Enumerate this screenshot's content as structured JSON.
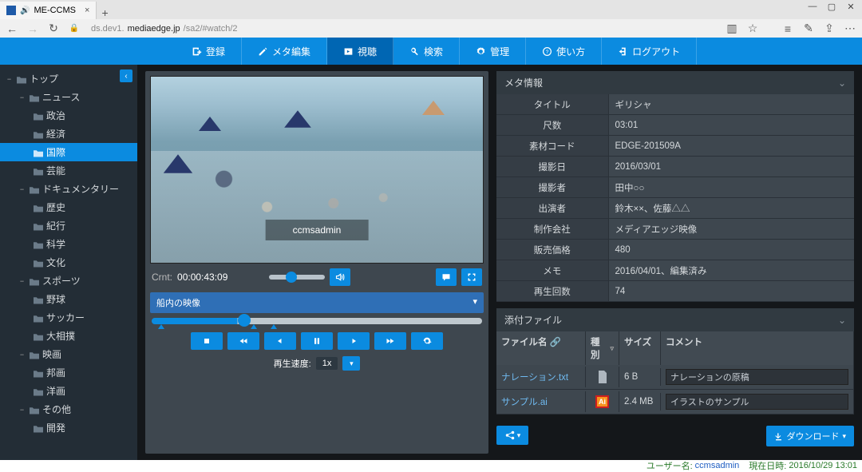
{
  "browser": {
    "tab_title": "ME-CCMS",
    "url_prefix": "ds.dev1.",
    "url_domain": "mediaedge.jp",
    "url_suffix": "/sa2/#watch/2"
  },
  "nav": {
    "register": "登録",
    "meta_edit": "メタ編集",
    "watch": "視聴",
    "search": "検索",
    "manage": "管理",
    "usage": "使い方",
    "logout": "ログアウト"
  },
  "tree": {
    "root": "トップ",
    "cats": [
      {
        "label": "ニュース",
        "children": [
          "政治",
          "経済",
          "国際",
          "芸能"
        ],
        "sel": 2
      },
      {
        "label": "ドキュメンタリー",
        "children": [
          "歴史",
          "紀行",
          "科学",
          "文化"
        ]
      },
      {
        "label": "スポーツ",
        "children": [
          "野球",
          "サッカー",
          "大相撲"
        ]
      },
      {
        "label": "映画",
        "children": [
          "邦画",
          "洋画"
        ]
      },
      {
        "label": "その他",
        "children": [
          "開発"
        ]
      }
    ]
  },
  "player": {
    "watermark": "ccmsadmin",
    "crnt_label": "Crnt:",
    "crnt_value": "00:00:43:09",
    "clip_label": "船内の映像",
    "speed_label": "再生速度:",
    "speed_value": "1x"
  },
  "meta": {
    "head": "メタ情報",
    "rows": [
      {
        "k": "タイトル",
        "v": "ギリシャ"
      },
      {
        "k": "尺数",
        "v": "03:01"
      },
      {
        "k": "素材コード",
        "v": "EDGE-201509A"
      },
      {
        "k": "撮影日",
        "v": "2016/03/01"
      },
      {
        "k": "撮影者",
        "v": "田中○○"
      },
      {
        "k": "出演者",
        "v": "鈴木××、佐藤△△"
      },
      {
        "k": "制作会社",
        "v": "メディアエッジ映像"
      },
      {
        "k": "販売価格",
        "v": "480"
      },
      {
        "k": "メモ",
        "v": "2016/04/01、編集済み"
      },
      {
        "k": "再生回数",
        "v": "74"
      }
    ]
  },
  "attachments": {
    "head": "添付ファイル",
    "cols": {
      "file": "ファイル名",
      "type": "種別",
      "size": "サイズ",
      "comment": "コメント"
    },
    "rows": [
      {
        "file": "ナレーション.txt",
        "type": "txt",
        "size": "6 B",
        "comment": "ナレーションの原稿"
      },
      {
        "file": "サンプル.ai",
        "type": "ai",
        "size": "2.4 MB",
        "comment": "イラストのサンプル"
      }
    ],
    "download": "ダウンロード"
  },
  "status": {
    "user_label": "ユーザー名:",
    "user_value": "ccmsadmin",
    "time_label": "現在日時:",
    "time_value": "2016/10/29 13:01"
  }
}
